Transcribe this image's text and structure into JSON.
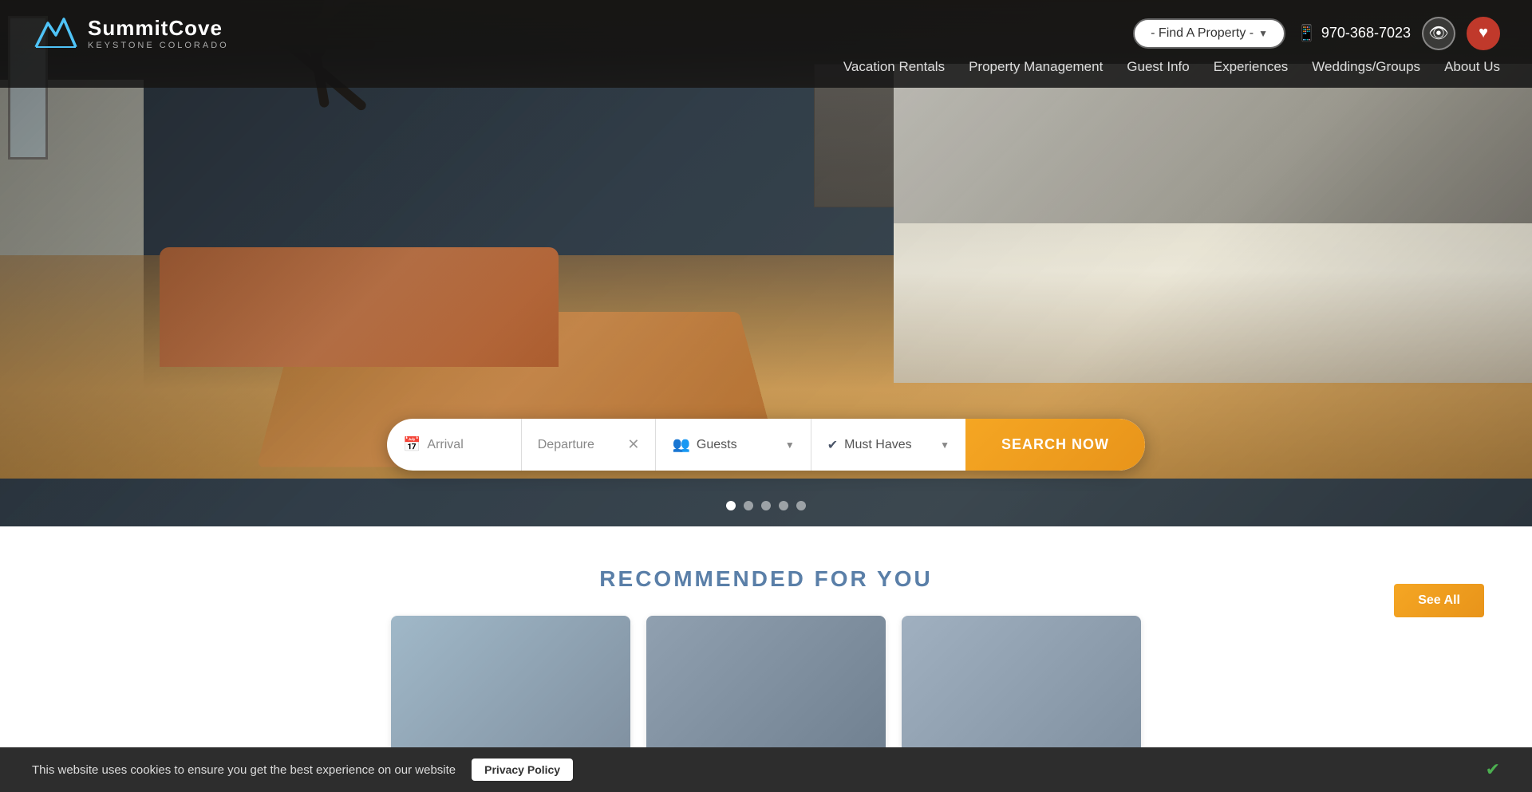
{
  "site": {
    "name": "SummitCove",
    "tagline": "Keystone Colorado",
    "phone": "970-368-7023"
  },
  "header": {
    "find_property_btn": "- Find A Property -",
    "nav": {
      "vacation_rentals": "Vacation Rentals",
      "property_management": "Property Management",
      "guest_info": "Guest Info",
      "experiences": "Experiences",
      "weddings_groups": "Weddings/Groups",
      "about_us": "About Us"
    }
  },
  "hero": {
    "search": {
      "arrival_placeholder": "Arrival",
      "departure_placeholder": "Departure",
      "guests_placeholder": "Guests",
      "must_haves_placeholder": "Must Haves",
      "search_button": "SEARCH NOW"
    },
    "slides": [
      1,
      2,
      3,
      4,
      5
    ],
    "active_slide": 0
  },
  "recommended": {
    "title": "RECOMMENDED FOR YOU",
    "see_all_label": "See All"
  },
  "cookie": {
    "message": "This website uses cookies to ensure you get the best experience on our website",
    "privacy_policy_btn": "Privacy Policy"
  }
}
